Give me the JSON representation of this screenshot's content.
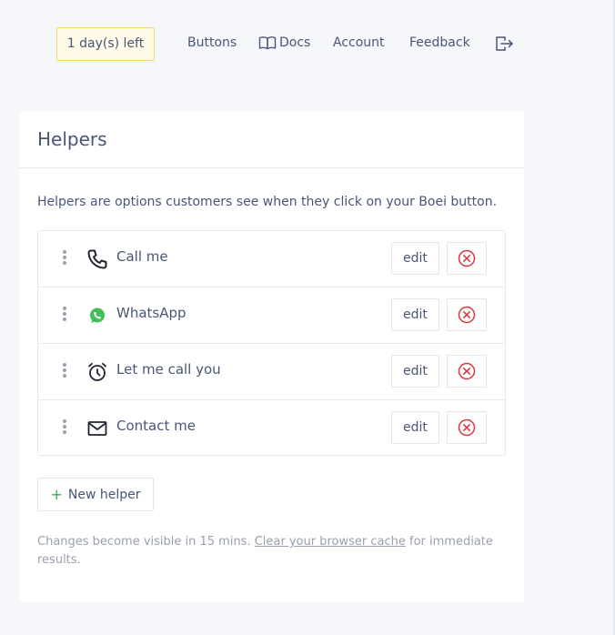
{
  "nav": {
    "trial_badge": "1 day(s) left",
    "links": {
      "buttons": "Buttons",
      "docs": "Docs",
      "account": "Account",
      "feedback": "Feedback"
    },
    "logout_icon": "logout-icon"
  },
  "card": {
    "title": "Helpers",
    "intro": "Helpers are options customers see when they click on your Boei button.",
    "helpers": [
      {
        "label": "Call me",
        "icon": "phone-icon",
        "edit_label": "edit"
      },
      {
        "label": "WhatsApp",
        "icon": "whatsapp-icon",
        "edit_label": "edit"
      },
      {
        "label": "Let me call you",
        "icon": "alarm-clock-icon",
        "edit_label": "edit"
      },
      {
        "label": "Contact me",
        "icon": "envelope-icon",
        "edit_label": "edit"
      }
    ],
    "new_helper_label": "New helper",
    "footnote": {
      "before": "Changes become visible in 15 mins.",
      "link": "Clear your browser cache",
      "after": "for immediate results."
    }
  },
  "colors": {
    "text": "#4a5578",
    "muted": "#9aa0ad",
    "delete": "#d9363e",
    "whatsapp": "#3fbf58",
    "badge_border": "#f3d777"
  }
}
